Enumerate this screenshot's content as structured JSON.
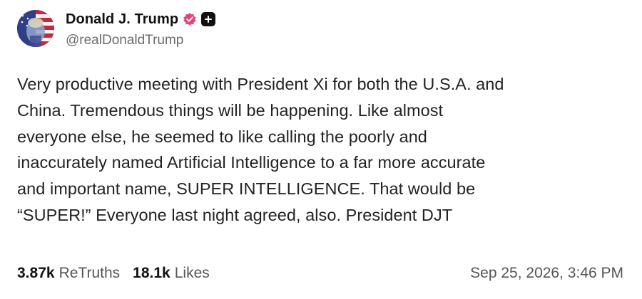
{
  "author": {
    "display_name": "Donald J. Trump",
    "handle": "@realDonaldTrump",
    "avatar_icon": "profile-photo-flag-avatar",
    "verified_icon": "verified-badge-icon",
    "verified_color": "#e0457b",
    "follow_icon": "plus-icon"
  },
  "post": {
    "text": "Very productive meeting with President Xi for both the U.S.A. and\nChina. Tremendous things will be happening. Like almost\neveryone else, he seemed to like calling the poorly and\ninaccurately named Artificial Intelligence to a far more accurate\nand important name, SUPER INTELLIGENCE. That would be\n“SUPER!” Everyone last night agreed, also. President DJT"
  },
  "stats": {
    "retruths_count": "3.87k",
    "retruths_label": "ReTruths",
    "likes_count": "18.1k",
    "likes_label": "Likes"
  },
  "timestamp": "Sep 25, 2026, 3:46 PM"
}
